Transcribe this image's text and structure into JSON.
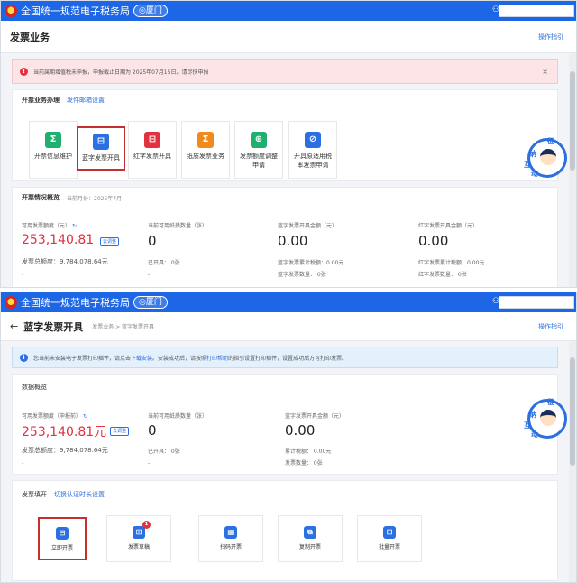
{
  "header": {
    "site_title": "全国统一规范电子税务局",
    "region": "◎厦门",
    "user_icon": "person-icon"
  },
  "screen1": {
    "page_title": "发票业务",
    "ops_link": "操作指引",
    "alert": {
      "text": "当前属期增值税未申报，申报截止日期为 2025年07月15日。请尽快申报",
      "close": "×"
    },
    "invoice_card": {
      "title": "开票业务办理",
      "link": "发件邮箱设置",
      "tiles": [
        {
          "label": "开票信息维护",
          "icon": "invoice-info-icon",
          "color": "#1fb06f"
        },
        {
          "label": "蓝字发票开具",
          "icon": "blue-invoice-icon",
          "color": "#2b6fe0"
        },
        {
          "label": "红字发票开具",
          "icon": "red-invoice-icon",
          "color": "#e2313f"
        },
        {
          "label": "纸质发票业务",
          "icon": "paper-invoice-icon",
          "color": "#f08a1c"
        },
        {
          "label": "发票额度调整申请",
          "icon": "quota-adjust-icon",
          "color": "#1fb06f"
        },
        {
          "label": "开具原适用税率发票申请",
          "icon": "tax-rate-apply-icon",
          "color": "#2b6fe0"
        }
      ]
    },
    "overview": {
      "title": "开票情况概览",
      "month_label": "当前月份：2025年7月",
      "available_label": "可用发票额度（元）",
      "available_amount": "253,140.81",
      "adjust_tag": "去调整",
      "remaining_label": "当前可用纸质数量（张）",
      "remaining_value": "0",
      "blue_total_label": "蓝字发票开具金额（元）",
      "blue_total_value": "0.00",
      "red_total_label": "红字发票开具金额（元）",
      "red_total_value": "0.00",
      "total_quota": "发票总额度：9,784,078.64元",
      "issued": "已开具：  0张",
      "blue_tax": "蓝字发票累计税额：0.00元",
      "red_tax": "红字发票累计税额：0.00元",
      "blue_count": "蓝字发票数量：  0张",
      "red_count": "红字发票数量：  0张",
      "dash": "-"
    }
  },
  "screen2": {
    "page_title": "蓝字发票开具",
    "breadcrumb": "发票业务 > 蓝字发票开具",
    "ops_link": "操作指引",
    "back_icon": "back-arrow-icon",
    "info": {
      "text_a": "您当前未安装电子发票打印插件，请点击",
      "link_a": "下载安装",
      "text_b": "。安装成功后，请按照",
      "link_b": "打印帮助",
      "text_c": "的指引设置打印插件，设置成功后方可打印发票。"
    },
    "overview": {
      "title": "数据概览",
      "available_label": "可用发票额度（申报前）",
      "available_amount": "253,140.81元",
      "adjust_tag": "去调整",
      "remaining_label": "当前可用纸质数量（张）",
      "remaining_value": "0",
      "blue_total_label": "蓝字发票开具金额（元）",
      "blue_total_value": "0.00",
      "total_quota": "发票总额度：9,784,078.64元",
      "issued": "已开具：  0张",
      "tax": "累计税额：  0.00元",
      "count": "发票数量：  0张",
      "dash": "-"
    },
    "fill": {
      "title": "发票填开",
      "link": "切换认证时长设置",
      "tiles": [
        {
          "label": "立即开票",
          "icon": "issue-now-icon"
        },
        {
          "label": "发票草稿",
          "icon": "draft-icon",
          "badge": "1"
        },
        {
          "label": "扫码开票",
          "icon": "scan-code-icon"
        },
        {
          "label": "复制开票",
          "icon": "copy-invoice-icon"
        },
        {
          "label": "批量开票",
          "icon": "batch-invoice-icon"
        }
      ]
    }
  },
  "mascot": {
    "chars": [
      "征",
      "纳",
      "互",
      "动"
    ]
  }
}
